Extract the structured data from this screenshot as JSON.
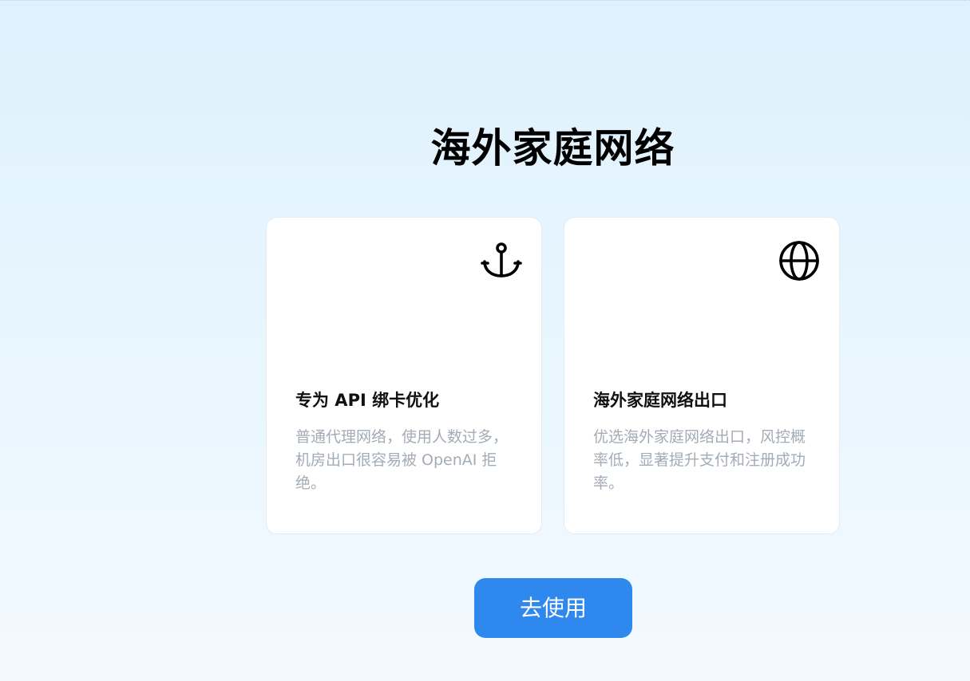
{
  "page": {
    "title": "海外家庭网络"
  },
  "cards": [
    {
      "icon": "anchor-icon",
      "title": "专为 API 绑卡优化",
      "description": "普通代理网络，使用人数过多，机房出口很容易被 OpenAI 拒绝。"
    },
    {
      "icon": "globe-icon",
      "title": "海外家庭网络出口",
      "description": "优选海外家庭网络出口，风控概率低，显著提升支付和注册成功率。"
    }
  ],
  "cta": {
    "label": "去使用"
  },
  "colors": {
    "accent": "#2f88ee",
    "background_top": "#dff1fd",
    "background_bottom": "#f3faff",
    "muted_text": "#a3acb6"
  }
}
